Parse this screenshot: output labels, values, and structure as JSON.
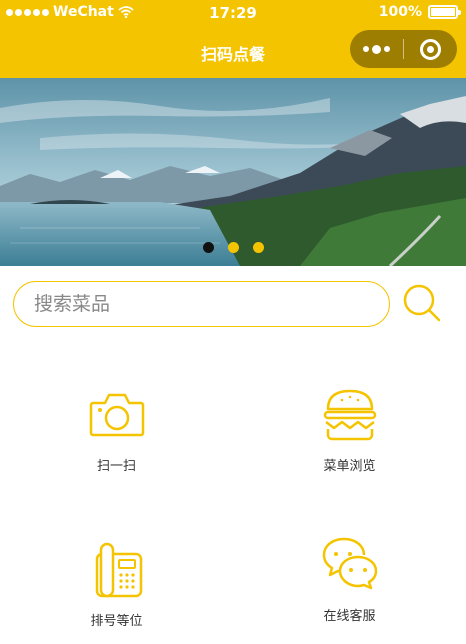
{
  "status_bar": {
    "carrier": "WeChat",
    "time": "17:29",
    "battery": "100%"
  },
  "nav_bar": {
    "title": "扫码点餐"
  },
  "banner": {
    "slide_count": 3,
    "active_index": 0
  },
  "search": {
    "placeholder": "搜索菜品",
    "value": ""
  },
  "menu": [
    {
      "label": "扫一扫",
      "icon": "camera-icon"
    },
    {
      "label": "菜单浏览",
      "icon": "burger-icon"
    },
    {
      "label": "排号等位",
      "icon": "phone-icon"
    },
    {
      "label": "在线客服",
      "icon": "chat-icon"
    }
  ],
  "colors": {
    "accent": "#F5C400",
    "capsule": "#9E7E00",
    "label_text": "#333333"
  }
}
